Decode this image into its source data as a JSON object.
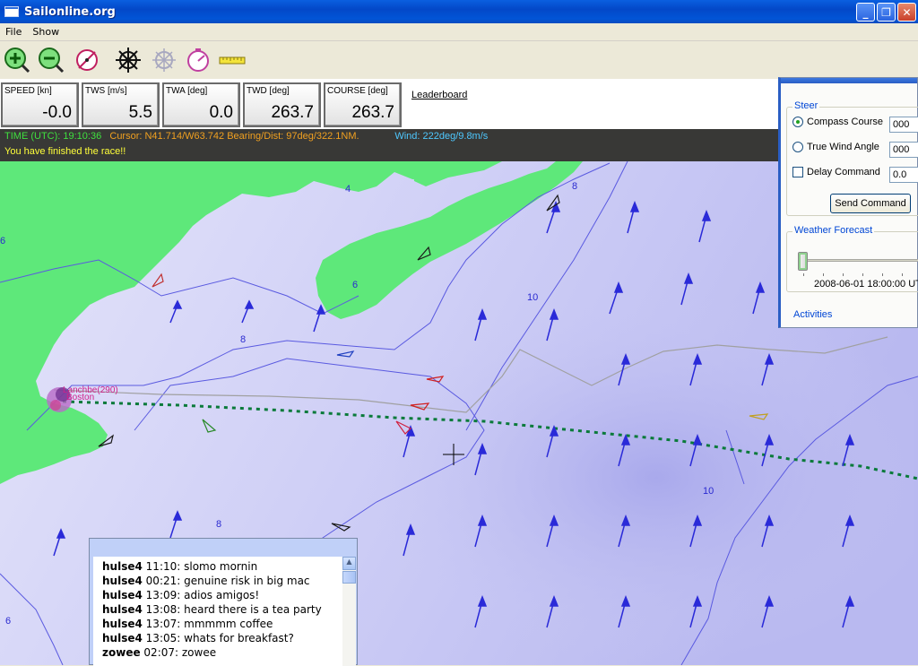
{
  "window": {
    "title": "Sailonline.org",
    "minimize": "_",
    "maximize": "❐",
    "close": "✕"
  },
  "menu": [
    "File",
    "Show"
  ],
  "toolbar": [
    {
      "icon": "zoom-in-icon"
    },
    {
      "icon": "zoom-out-icon"
    },
    {
      "icon": "compass-icon"
    },
    {
      "icon": "helm-wheel-icon"
    },
    {
      "icon": "crosshair-wheel-icon"
    },
    {
      "icon": "clock-gauge-icon"
    },
    {
      "icon": "ruler-icon"
    }
  ],
  "gauges": [
    {
      "label": "SPEED [kn]",
      "value": "-0.0"
    },
    {
      "label": "TWS [m/s]",
      "value": "5.5"
    },
    {
      "label": "TWA [deg]",
      "value": "0.0"
    },
    {
      "label": "TWD [deg]",
      "value": "263.7"
    },
    {
      "label": "COURSE [deg]",
      "value": "263.7"
    }
  ],
  "leaderboard": "Leaderboard",
  "status": {
    "time": "TIME (UTC): 19:10:36",
    "cursor": "Cursor: N41.714/W63.742 Bearing/Dist: 97deg/322.1NM.",
    "wind": "Wind: 222deg/9.8m/s",
    "message": "You have finished the race!!",
    "colors": {
      "time": "#3fe03f",
      "cursor": "#f0a020",
      "wind": "#4ec8ff"
    }
  },
  "steer": {
    "title": "Steer",
    "options": [
      {
        "label": "Compass Course",
        "value": "000",
        "selected": true
      },
      {
        "label": "True Wind Angle",
        "value": "000",
        "selected": false
      },
      {
        "label": "Delay Command",
        "value": "0.0",
        "checked": false
      }
    ],
    "send_button": "Send Command"
  },
  "forecast": {
    "title": "Weather Forecast",
    "date": "2008-06-01 18:00:00 UT"
  },
  "activities": "Activities",
  "map": {
    "boat_label": "Lanchbe(290)",
    "place_label": "Boston",
    "isobar_labels": [
      "4",
      "6",
      "6",
      "8",
      "8",
      "10",
      "10",
      "8",
      "6"
    ]
  },
  "chat": [
    {
      "user": "hulse4",
      "time": "11:10",
      "msg": "slomo mornin"
    },
    {
      "user": "hulse4",
      "time": "00:21",
      "msg": "genuine risk in big mac"
    },
    {
      "user": "hulse4",
      "time": "13:09",
      "msg": "adios amigos!"
    },
    {
      "user": "hulse4",
      "time": "13:08",
      "msg": "heard there is a tea party"
    },
    {
      "user": "hulse4",
      "time": "13:07",
      "msg": "mmmmm coffee"
    },
    {
      "user": "hulse4",
      "time": "13:05",
      "msg": "whats for breakfast?"
    },
    {
      "user": "zowee",
      "time": "02:07",
      "msg": "zowee"
    }
  ]
}
